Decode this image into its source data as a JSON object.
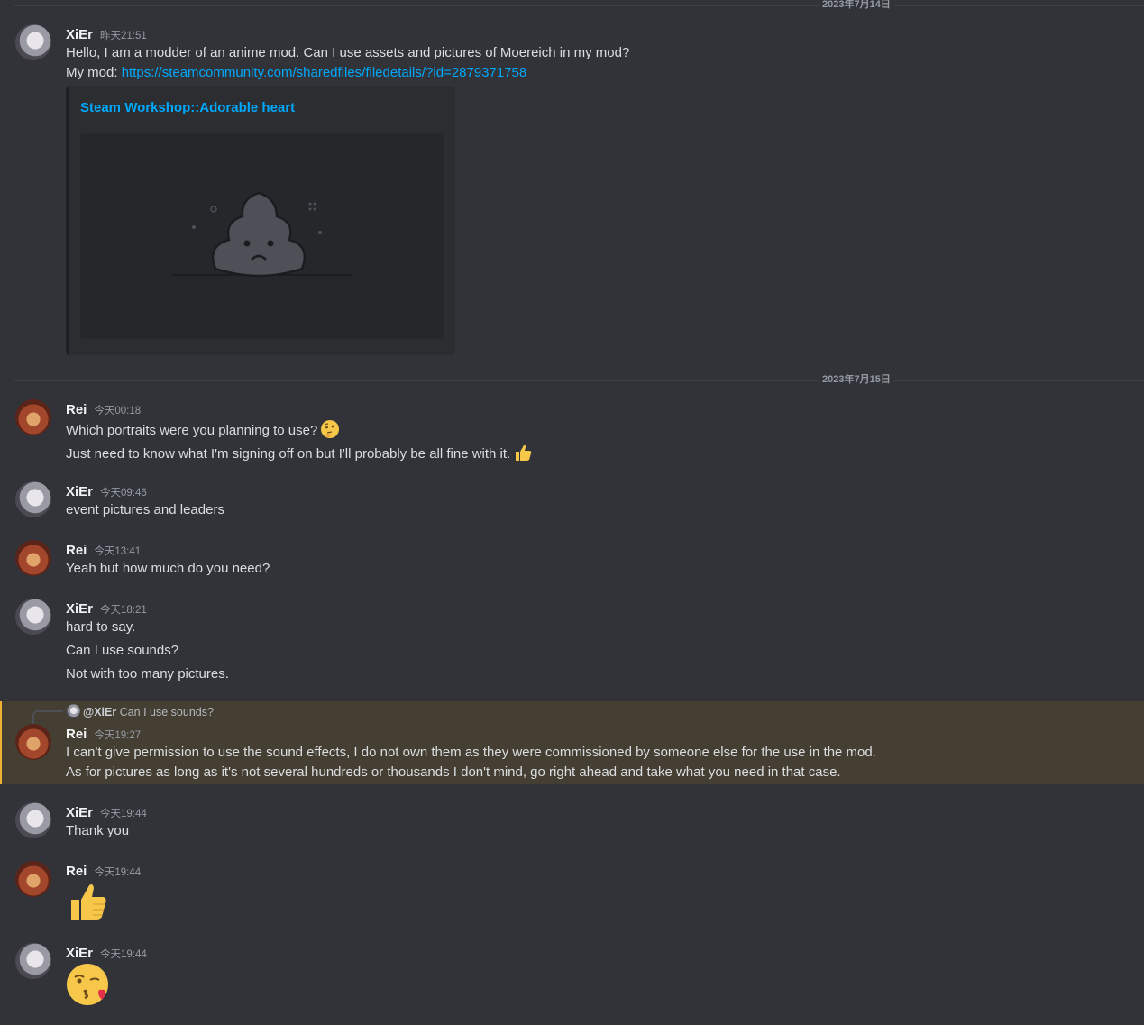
{
  "dates": {
    "first": "2023年7月14日",
    "second": "2023年7月15日"
  },
  "messages": {
    "m1": {
      "user": "XiEr",
      "time": "昨天21:51",
      "lines": [
        "Hello, I am  a modder of an anime mod. Can I use assets and pictures of Moereich in my mod?"
      ],
      "mod_label": "My mod: ",
      "mod_link": "https://steamcommunity.com/sharedfiles/filedetails/?id=2879371758",
      "embed_title": "Steam Workshop::Adorable heart"
    },
    "m2": {
      "user": "Rei",
      "time": "今天00:18",
      "line1": "Which portraits were you planning to use?",
      "line2": "Just need to know what I'm signing off on but I'll probably be all fine with it.",
      "emoji1": "thinking-face",
      "emoji2": "thumbs-up"
    },
    "m3": {
      "user": "XiEr",
      "time": "今天09:46",
      "line1": "event pictures and leaders"
    },
    "m4": {
      "user": "Rei",
      "time": "今天13:41",
      "line1": "Yeah but how much do you need?"
    },
    "m5": {
      "user": "XiEr",
      "time": "今天18:21",
      "line1": "hard to say.",
      "line2": "Can I use sounds?",
      "line3": "Not with too many pictures."
    },
    "m6": {
      "reply_user": "@XiEr",
      "reply_text": "Can I use sounds?",
      "user": "Rei",
      "time": "今天19:27",
      "line1": "I can't give permission to use the sound effects, I do not own them as they were commissioned by someone else for the use in the mod.",
      "line2": "As for pictures as long as it's not several hundreds or thousands I don't mind, go right ahead and take what you need in that case."
    },
    "m7": {
      "user": "XiEr",
      "time": "今天19:44",
      "line1": "Thank you"
    },
    "m8": {
      "user": "Rei",
      "time": "今天19:44",
      "emoji": "thumbs-up"
    },
    "m9": {
      "user": "XiEr",
      "time": "今天19:44",
      "emoji": "face-blowing-kiss"
    }
  },
  "colors": {
    "background": "#313338",
    "link": "#00a8fc",
    "highlight": "#443e33",
    "highlight_bar": "#f0b232"
  }
}
